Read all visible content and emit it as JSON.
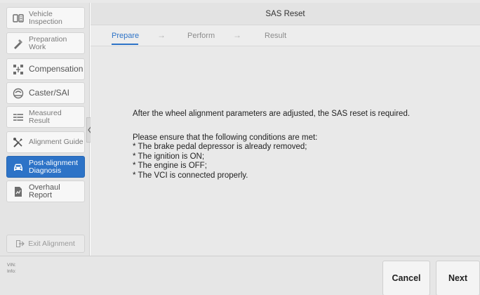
{
  "sidebar": {
    "items": [
      {
        "label": "Vehicle Inspection",
        "icon": "vehicle-inspection-icon"
      },
      {
        "label": "Preparation Work",
        "icon": "preparation-icon"
      },
      {
        "label": "Compensation",
        "icon": "compensation-icon"
      },
      {
        "label": "Caster/SAI",
        "icon": "caster-icon"
      },
      {
        "label": "Measured Result",
        "icon": "measured-result-icon"
      },
      {
        "label": "Alignment Guide",
        "icon": "alignment-guide-icon"
      },
      {
        "label": "Post-alignment Diagnosis",
        "icon": "car-icon"
      },
      {
        "label": "Overhaul Report",
        "icon": "report-icon"
      }
    ],
    "active_index": 6,
    "exit_label": "Exit Alignment"
  },
  "header": {
    "title": "SAS Reset"
  },
  "steps": [
    {
      "label": "Prepare",
      "active": true
    },
    {
      "label": "Perform",
      "active": false
    },
    {
      "label": "Result",
      "active": false
    }
  ],
  "step_arrow": "→",
  "content": {
    "intro": "After the wheel alignment parameters are adjusted, the SAS reset is required.",
    "conditions_heading": "Please ensure that the following conditions are met:",
    "conditions": [
      "* The brake pedal depressor is already removed;",
      "* The ignition is ON;",
      "* The engine is OFF;",
      "* The VCI is connected properly."
    ]
  },
  "footer": {
    "vin_label": "VIN:",
    "info_label": "Info:",
    "cancel_label": "Cancel",
    "next_label": "Next"
  },
  "colors": {
    "accent": "#2d73c7",
    "sidebar_bg": "#e4e4e4",
    "main_bg": "#e9e9e9"
  }
}
